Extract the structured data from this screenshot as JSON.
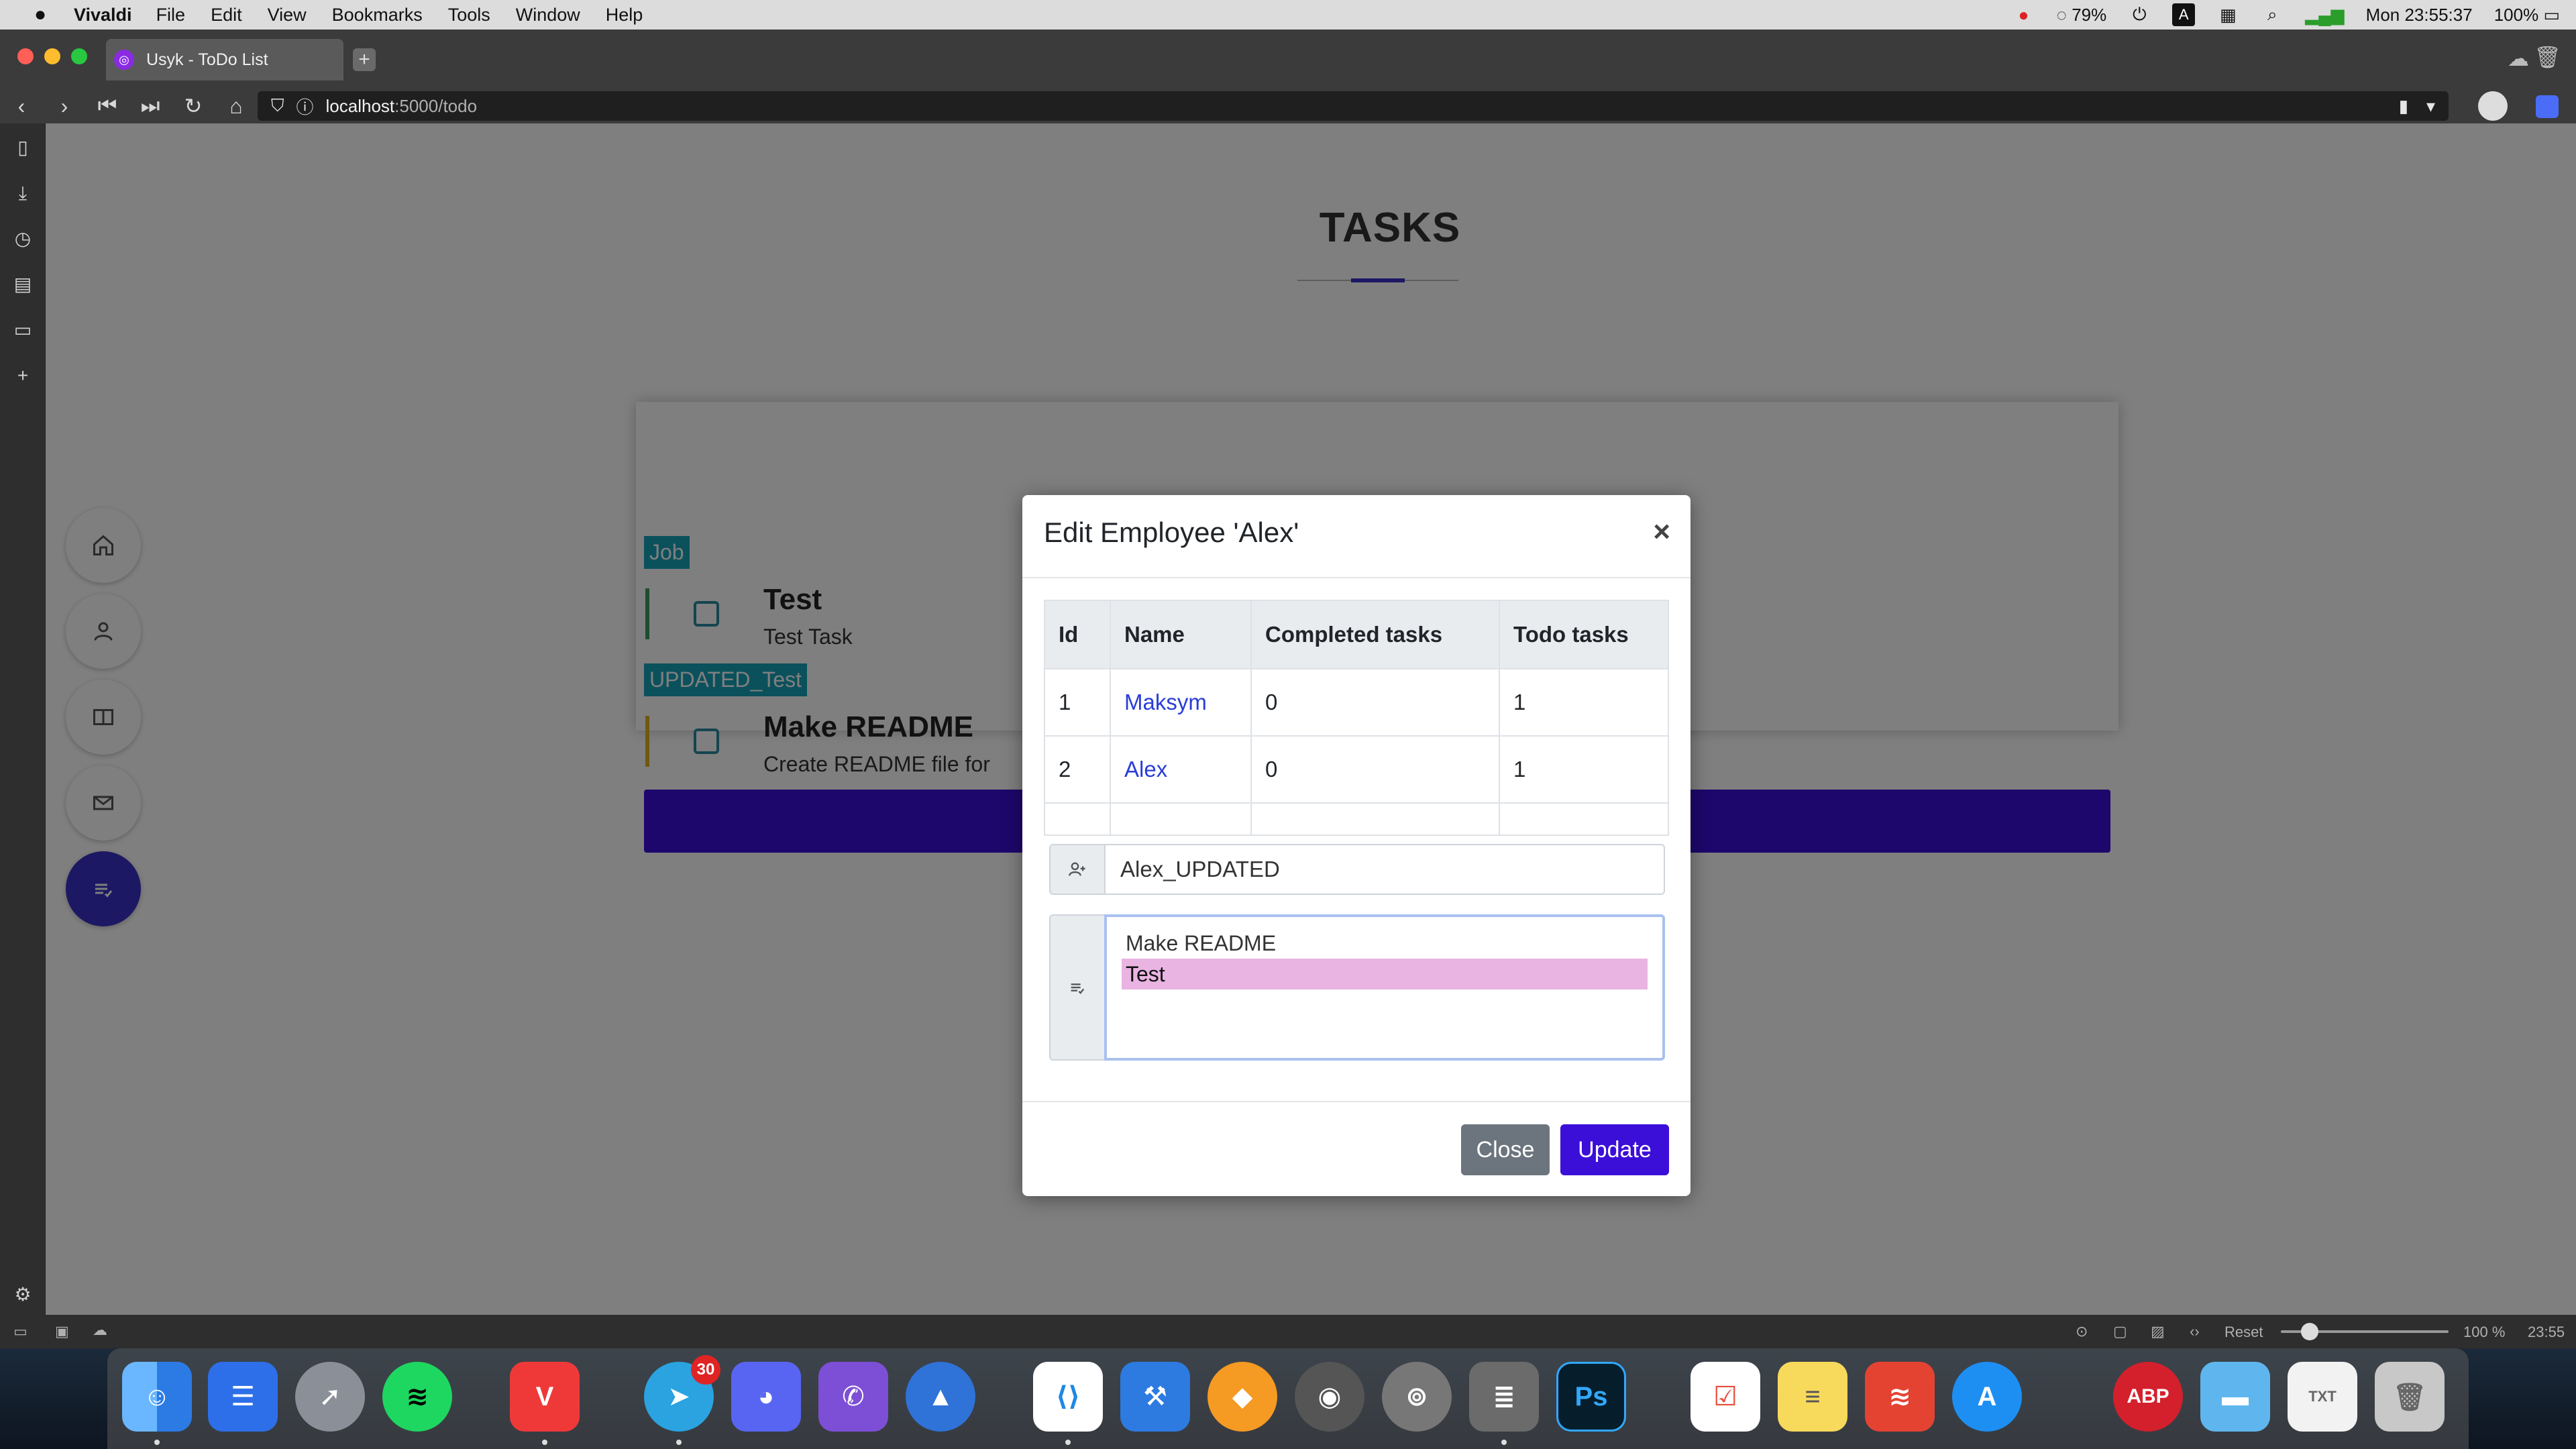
{
  "menubar": {
    "app_name": "Vivaldi",
    "items": [
      "File",
      "Edit",
      "View",
      "Bookmarks",
      "Tools",
      "Window",
      "Help"
    ],
    "battery_cpu": "79%",
    "clock": "Mon 23:55:37",
    "battery": "100%"
  },
  "browser": {
    "tab_title": "Usyk - ToDo List",
    "url_host": "localhost",
    "url_path": ":5000/todo"
  },
  "page": {
    "title": "TASKS",
    "tasks": [
      {
        "category": "Job",
        "title": "Test",
        "description": "Test Task"
      },
      {
        "category": "UPDATED_Test",
        "title": "Make README",
        "description": "Create README file for"
      }
    ]
  },
  "modal": {
    "title": "Edit Employee 'Alex'",
    "close_symbol": "×",
    "table": {
      "headers": [
        "Id",
        "Name",
        "Completed tasks",
        "Todo tasks"
      ],
      "rows": [
        {
          "id": "1",
          "name": "Maksym",
          "completed": "0",
          "todo": "1"
        },
        {
          "id": "2",
          "name": "Alex",
          "completed": "0",
          "todo": "1"
        }
      ]
    },
    "name_value": "Alex_UPDATED",
    "task_options": [
      "Make README",
      "Test"
    ],
    "selected_task": "Test",
    "close_button": "Close",
    "update_button": "Update"
  },
  "statusbar": {
    "reset": "Reset",
    "zoom": "100 %",
    "time": "23:55"
  },
  "dock": {
    "telegram_badge": "30"
  },
  "colors": {
    "accent": "#3b0fd8",
    "badge": "#17a2b8",
    "secondary_button": "#6c757d"
  }
}
